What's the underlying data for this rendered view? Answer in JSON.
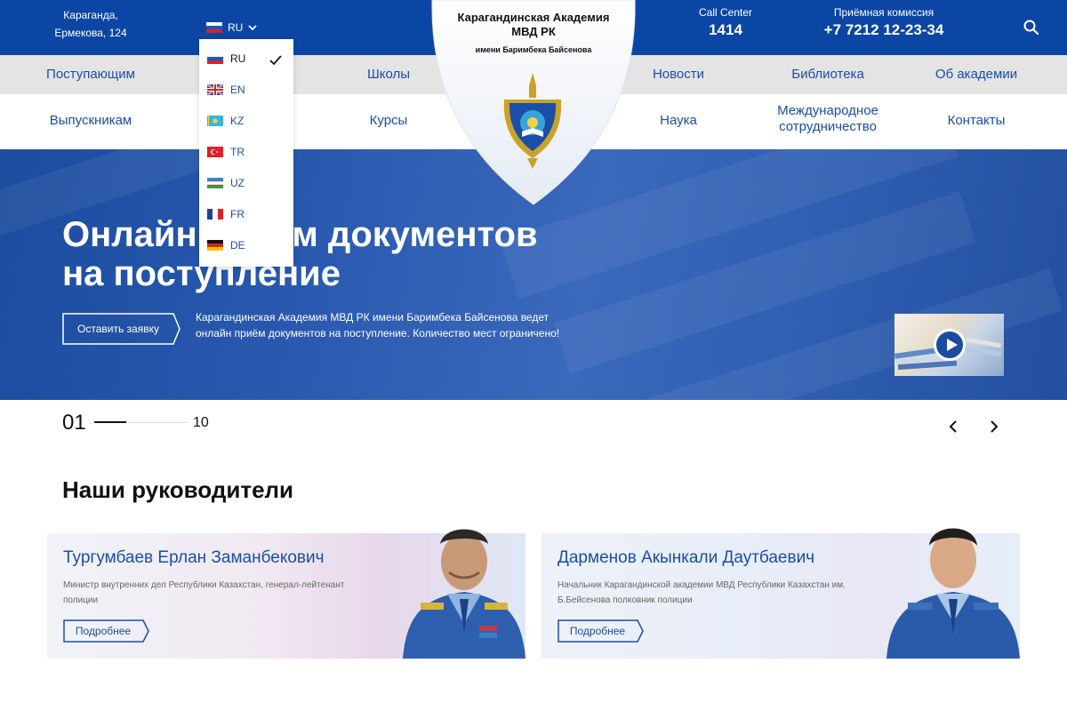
{
  "header": {
    "address_line1": "Караганда,",
    "address_line2": "Ермекова, 124",
    "language": "RU",
    "call_center_label": "Call Center",
    "call_center_number": "1414",
    "admission_label": "Приёмная комиссия",
    "admission_number": "+7 7212 12-23-34"
  },
  "logo": {
    "title": "Карагандинская Академия МВД РК",
    "subtitle": "имени Баримбека Байсенова"
  },
  "nav": {
    "row1": [
      "Поступающим",
      "Школы",
      "Новости",
      "Библиотека",
      "Об академии"
    ],
    "row2": [
      "Выпускникам",
      "Курсы",
      "Наука",
      "Международное",
      "сотрудничество",
      "Контакты"
    ]
  },
  "language_menu": {
    "items": [
      "RU",
      "EN",
      "KZ",
      "TR",
      "UZ",
      "FR",
      "DE"
    ],
    "selected": "RU"
  },
  "hero": {
    "title_line1": "Онлайн приём документов",
    "title_line2": "на поступление",
    "button": "Оставить заявку",
    "description": "Карагандинская Академия МВД РК имени Баримбека Байсенова ведет онлайн приём документов на поступление. Количество мест ограничено!"
  },
  "slider": {
    "current": "01",
    "total": "10",
    "progress": 0.1
  },
  "leaders": {
    "title": "Наши руководители",
    "cards": [
      {
        "name": "Тургумбаев Ерлан Заманбекович",
        "position": "Министр внутренних дел Республики Казахстан, генерал-лейтенант полиции",
        "button": "Подробнее"
      },
      {
        "name": "Дарменов Акынкали Даутбаевич",
        "position": "Начальник Карагандинской академии МВД Республики Казахстан им. Б.Бейсенова полковник полиции",
        "button": "Подробнее"
      }
    ]
  },
  "colors": {
    "brand_blue": "#0b46a5",
    "link_blue": "#1a4ea8",
    "nav_gray": "#e4e4e4"
  }
}
